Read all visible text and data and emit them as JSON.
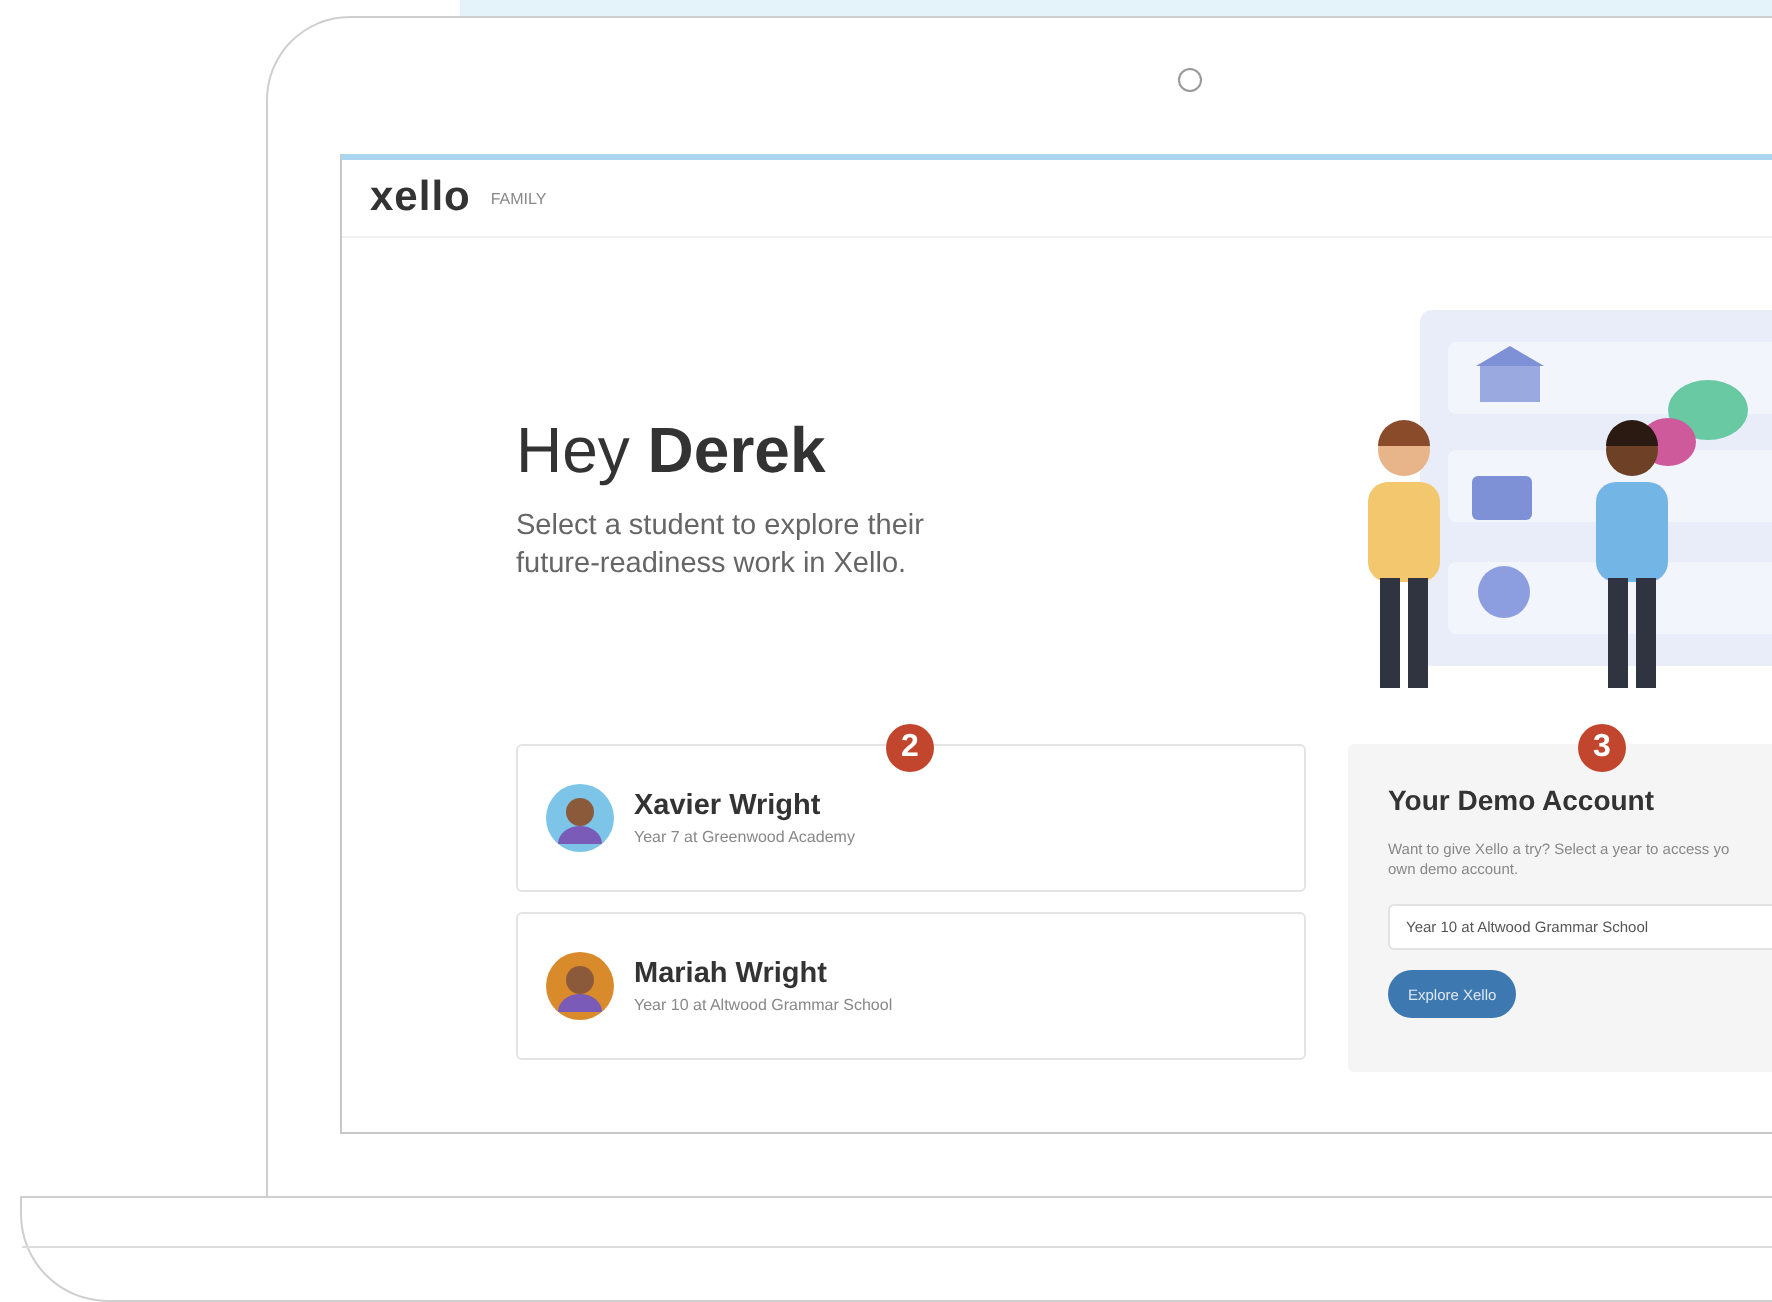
{
  "header": {
    "logo": "xello",
    "product": "FAMILY"
  },
  "greeting": {
    "text": "Hey **Derek**",
    "subtitle": "Select a student to explore their future-readiness work in Xello."
  },
  "students": {
    "badge": "2",
    "items": [
      {
        "name": "Xavier Wright",
        "detail": "Year 7 at Greenwood Academy",
        "color": "#7cc4e8"
      },
      {
        "name": "Mariah Wright",
        "detail": "Year 10 at Altwood Grammar School",
        "color": "#d98a2b"
      }
    ]
  },
  "demo": {
    "badge": "3",
    "title": "Your Demo Account",
    "description_lines": [
      "Want to give Xello a try? Select a year to access yo",
      "own demo account."
    ],
    "select": {
      "value": "Year 10 at Altwood Grammar School"
    },
    "button": "Explore Xello"
  }
}
